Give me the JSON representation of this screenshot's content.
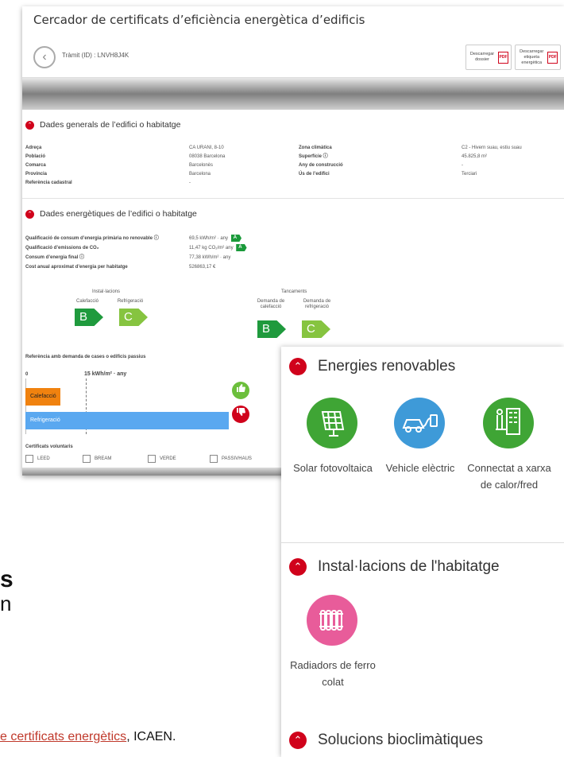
{
  "app": {
    "title": "Cercador de certificats d’eficiència energètica d’edificis",
    "tramit": "Tràmit (ID) : LNVH8J4K",
    "dl_dossier": "Descarregar dossier",
    "dl_etiqueta": "Descarregar etiqueta energètica",
    "pdf_icon_text": "PDF"
  },
  "general": {
    "heading": "Dades generals de l’edifici o habitatge",
    "rows": [
      {
        "label": "Adreça",
        "value": "CA URANI, 8-10",
        "label2": "Zona climàtica",
        "value2": "C2 - Hivern suau, estiu suau"
      },
      {
        "label": "Població",
        "value": "08038 Barcelona",
        "label2": "Superfície ⓘ",
        "value2": "45.825,8 m²"
      },
      {
        "label": "Comarca",
        "value": "Barcelonès",
        "label2": "Any de construcció",
        "value2": "-"
      },
      {
        "label": "Província",
        "value": "Barcelona",
        "label2": "Ús de l’edifici",
        "value2": "Terciari"
      },
      {
        "label": "Referència cadastral",
        "value": "-",
        "label2": "",
        "value2": ""
      }
    ]
  },
  "energetic": {
    "heading": "Dades energètiques de l’edifici o habitatge",
    "rows": [
      {
        "label": "Qualificació de consum d’energia primària no renovable ⓘ",
        "value": "69,5 kWh/m² · any",
        "badge": "A"
      },
      {
        "label": "Qualificació d’emissions de CO₂",
        "value": "11,47 kg CO₂/m² any",
        "badge": "A"
      },
      {
        "label": "Consum d’energia final ⓘ",
        "value": "77,38 kWh/m² · any",
        "badge": ""
      },
      {
        "label": "Cost anual aproximat d’energia per habitatge",
        "value": "526863,17 €",
        "badge": ""
      }
    ],
    "installations_title": "Instal·lacions",
    "enclosures_title": "Tancaments",
    "ratings": [
      {
        "label": "Calefacció",
        "grade": "B"
      },
      {
        "label": "Refrigeració",
        "grade": "C"
      },
      {
        "label": "Demanda de calefacció",
        "grade": "B"
      },
      {
        "label": "Demanda de refrigeració",
        "grade": "C"
      }
    ]
  },
  "reference": {
    "title": "Referència amb demanda de cases o edificis passius",
    "zero": "0",
    "threshold_label": "15 kWh/m² · any",
    "bars": [
      {
        "label": "Calefacció",
        "color": "#f0820f",
        "fraction": 0.172,
        "status": "up"
      },
      {
        "label": "Refrigeració",
        "color": "#5aa8f0",
        "fraction": 1.0,
        "status": "down"
      }
    ],
    "threshold_fraction": 0.295,
    "thumbs_up_color": "#6cbf3c",
    "thumbs_down_color": "#d0021b"
  },
  "voluntary": {
    "title": "Certificats voluntaris",
    "options": [
      "LEED",
      "BREAM",
      "VERDE",
      "PASSIVHAUS"
    ]
  },
  "overlay": {
    "renewables_heading": "Energies renovables",
    "renewables": [
      {
        "label": "Solar fotovoltaica",
        "color": "#3fa535",
        "icon": "solar-panel-icon"
      },
      {
        "label": "Vehicle elèctric",
        "color": "#3e9ad8",
        "icon": "electric-car-icon"
      },
      {
        "label": "Connectat a xarxa de calor/fred",
        "color": "#3fa535",
        "icon": "district-heating-icon"
      }
    ],
    "installations_heading": "Instal·lacions de l'habitatge",
    "installations": [
      {
        "label": "Radiadors de ferro colat",
        "color": "#e85c9a",
        "icon": "radiator-icon"
      }
    ],
    "bioclimatic_heading": "Solucions bioclimàtiques"
  },
  "background": {
    "fragment_bold": "s",
    "fragment_line": "n",
    "link_text": "e certificats energètics",
    "suffix": ", ICAEN."
  }
}
